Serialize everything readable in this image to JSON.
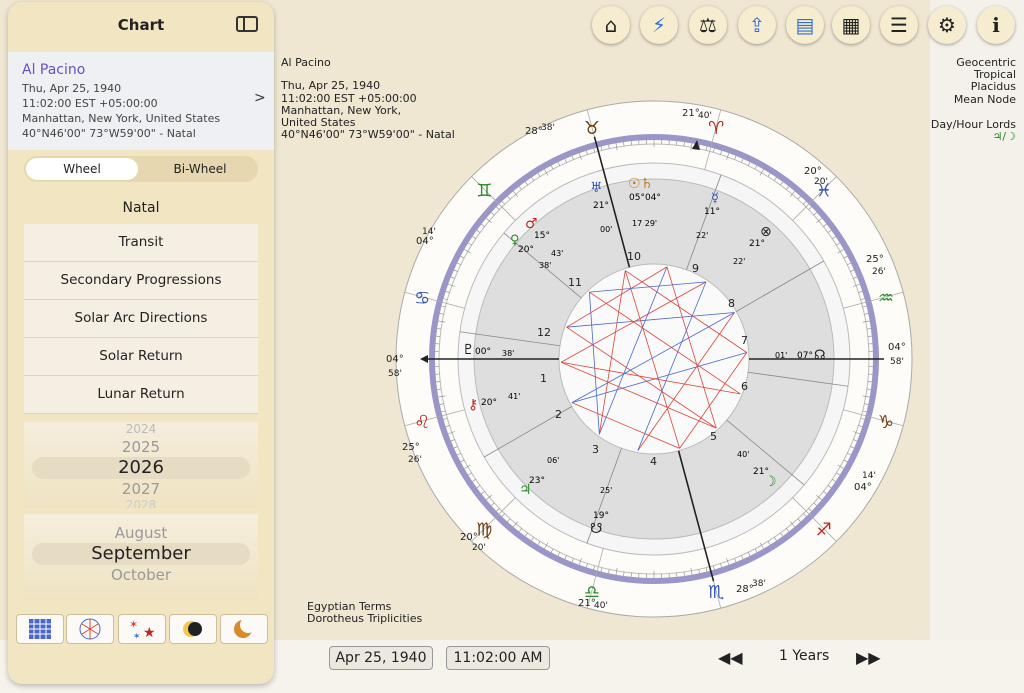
{
  "sidebar": {
    "title": "Chart",
    "person": {
      "name": "Al Pacino",
      "date": "Thu, Apr 25, 1940",
      "time": "11:02:00 EST +05:00:00",
      "place": "Manhattan, New York, United States",
      "coords": "40°N46'00\" 73°W59'00\" - Natal"
    },
    "segment": {
      "wheel": "Wheel",
      "biwheel": "Bi-Wheel"
    },
    "menu": {
      "natal": "Natal",
      "items": [
        "Transit",
        "Secondary Progressions",
        "Solar Arc Directions",
        "Solar Return",
        "Lunar Return"
      ]
    },
    "year_picker": {
      "above2": "2024",
      "above": "2025",
      "selected": "2026",
      "below": "2027",
      "below2": "2028"
    },
    "month_picker": {
      "above": "August",
      "selected": "September",
      "below": "October"
    },
    "bottom_icons": [
      "grid-icon",
      "aspect-pattern-icon",
      "stars-icon",
      "eclipse-icon",
      "moon-icon"
    ]
  },
  "toolbar": {
    "icons": [
      "home-icon",
      "lightning-icon",
      "scales-icon",
      "share-icon",
      "document-icon",
      "table-icon",
      "list-icon",
      "settings-icon",
      "info-icon"
    ]
  },
  "chart_info": {
    "name": "Al Pacino",
    "date": "Thu, Apr 25, 1940",
    "time": "11:02:00 EST +05:00:00",
    "place1": "Manhattan, New York,",
    "place2": "United States",
    "coords": "40°N46'00\" 73°W59'00\" - Natal"
  },
  "settings": {
    "line1": "Geocentric",
    "line2": "Tropical",
    "line3": "Placidus",
    "line4": "Mean Node",
    "lords": "Day/Hour Lords",
    "lords_symbols": "♃/☽"
  },
  "terms": {
    "line1": "Egyptian Terms",
    "line2": "Dorotheus Triplicities"
  },
  "cusps": {
    "top_deg": "21°",
    "top_min": "40'",
    "bottom_deg": "21°",
    "bottom_min": "40'",
    "left_deg": "04°",
    "left_min": "58'",
    "right_deg": "04°",
    "right_min": "58'",
    "c11_deg": "28°",
    "c11_min": "38'",
    "c9_deg": "20°",
    "c9_min": "20'",
    "c8_deg": "25°",
    "c8_min": "26'",
    "c12_deg": "14'",
    "c12_min": "04°",
    "c2_deg": "25°",
    "c2_min": "26'",
    "c3_deg": "20°",
    "c3_min": "20'",
    "c5_deg": "14'",
    "c5_min": "04°",
    "c4_deg": "28°",
    "c4_min": "38'"
  },
  "houses": [
    "1",
    "2",
    "3",
    "4",
    "5",
    "6",
    "7",
    "8",
    "9",
    "10",
    "11",
    "12"
  ],
  "zodiac": [
    {
      "glyph": "♉",
      "color": "#6b3a0e"
    },
    {
      "glyph": "♈",
      "color": "#c0261f"
    },
    {
      "glyph": "♓",
      "color": "#3353b8"
    },
    {
      "glyph": "♒",
      "color": "#2a8a2a"
    },
    {
      "glyph": "♑",
      "color": "#6b3a0e"
    },
    {
      "glyph": "♐",
      "color": "#c0261f"
    },
    {
      "glyph": "♏",
      "color": "#3353b8"
    },
    {
      "glyph": "♎",
      "color": "#2a8a2a"
    },
    {
      "glyph": "♍",
      "color": "#6b3a0e"
    },
    {
      "glyph": "♌",
      "color": "#c0261f"
    },
    {
      "glyph": "♋",
      "color": "#3353b8"
    },
    {
      "glyph": "♊",
      "color": "#2a8a2a"
    }
  ],
  "planets": [
    {
      "glyph": "♅",
      "deg": "21°",
      "min": "00'",
      "sign": "♉",
      "color": "#3353b8"
    },
    {
      "glyph": "☉♄",
      "deg": "05°04°",
      "min": "17 29'",
      "sign": "♉♉",
      "color": "#c07a1a"
    },
    {
      "glyph": "☿",
      "deg": "11°",
      "min": "22'",
      "sign": "♈",
      "color": "#3353b8"
    },
    {
      "glyph": "♂",
      "deg": "15°",
      "min": "43'",
      "sign": "♊",
      "color": "#c0261f"
    },
    {
      "glyph": "♀",
      "deg": "20°",
      "min": "38'",
      "sign": "♊",
      "color": "#2a8a2a"
    },
    {
      "glyph": "⊗",
      "deg": "21°",
      "min": "22'",
      "sign": "♓",
      "color": "#222"
    },
    {
      "glyph": "♇",
      "deg": "00°",
      "min": "38'",
      "sign": "♌",
      "color": "#222"
    },
    {
      "glyph": "☊",
      "deg": "07°",
      "min": "01'",
      "sign": "♎",
      "color": "#222"
    },
    {
      "glyph": "⚷",
      "deg": "20°",
      "min": "41'",
      "sign": "♌",
      "color": "#c0261f"
    },
    {
      "glyph": "♃",
      "deg": "23°",
      "min": "06'",
      "sign": "♏",
      "color": "#2a8a2a"
    },
    {
      "glyph": "☋",
      "deg": "19°",
      "min": "25'",
      "sign": "♎",
      "color": "#222"
    },
    {
      "glyph": "☽",
      "deg": "21°",
      "min": "40'",
      "sign": "♐",
      "color": "#2a8a2a"
    }
  ],
  "bottom": {
    "date": "Apr 25, 1940",
    "time": "11:02:00 AM",
    "step": "1 Years"
  },
  "colors": {
    "accent": "#6a4fc0",
    "red_aspect": "#d9453a",
    "blue_aspect": "#4a67c9",
    "ring": "#c9c7e0"
  }
}
